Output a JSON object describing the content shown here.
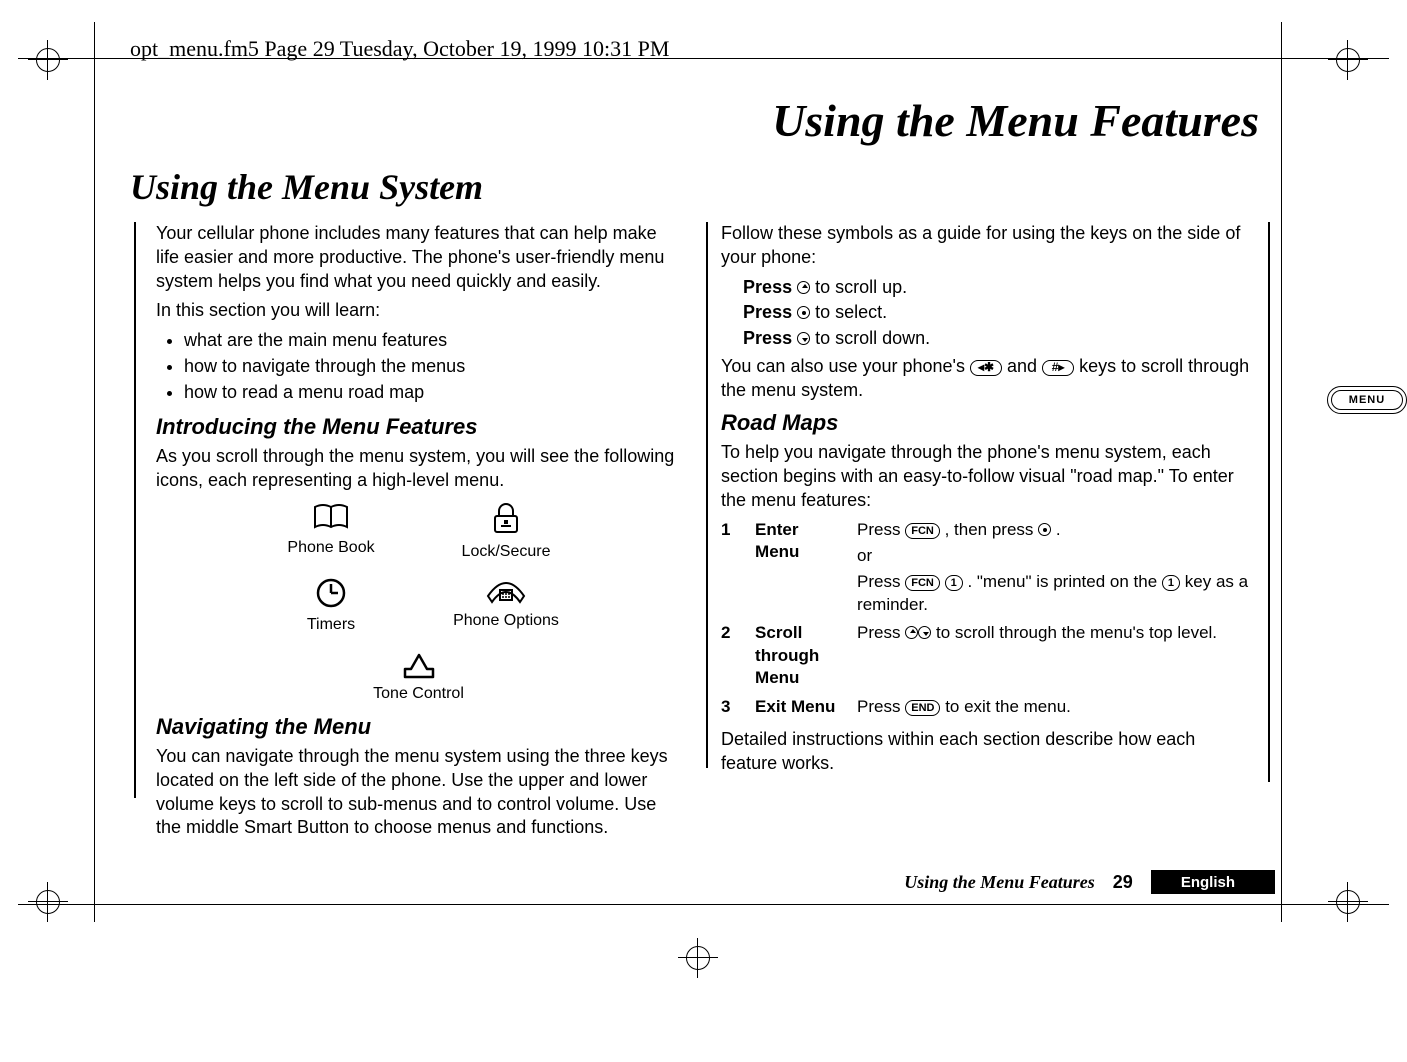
{
  "header": {
    "running_head": "opt_menu.fm5  Page 29  Tuesday, October 19, 1999  10:31 PM"
  },
  "chapter_title": "Using the Menu Features",
  "section_title": "Using the Menu System",
  "left_col": {
    "intro_p1": "Your cellular phone includes many features that can help make life easier and more productive. The phone's user-friendly menu system helps you find what you need quickly and easily.",
    "intro_p2": "In this section you will learn:",
    "bullets": [
      "what are the main menu features",
      "how to navigate through the menus",
      "how to read a menu road map"
    ],
    "h_intro": "Introducing the Menu Features",
    "intro_p3": "As you scroll through the menu system, you will see the following icons, each representing a high-level menu.",
    "icons": {
      "phone_book": "Phone Book",
      "lock_secure": "Lock/Secure",
      "timers": "Timers",
      "phone_options": "Phone Options",
      "tone_control": "Tone Control"
    },
    "h_nav": "Navigating the Menu",
    "nav_p": "You can navigate through the menu system using the three keys located on the left side of the phone. Use the upper and lower volume keys to scroll to sub-menus and to control volume. Use the middle Smart Button to choose menus and functions."
  },
  "right_col": {
    "follow_p": "Follow these symbols as a guide for using the keys on the side of your phone:",
    "press_up_label": "Press",
    "press_up_rest": " to scroll up.",
    "press_sel_label": "Press",
    "press_sel_rest": " to select.",
    "press_down_label": "Press",
    "press_down_rest": " to scroll down.",
    "also_pre": "You can also use your phone's ",
    "also_mid": " and ",
    "also_post": " keys to scroll through the menu system.",
    "arrow_left_label": "◂✱",
    "arrow_right_label": "#▸",
    "h_roadmaps": "Road Maps",
    "road_p": "To help you navigate through the phone's menu system, each section begins with an easy-to-follow visual \"road map.\" To enter the menu features:",
    "fcn_label": "FCN",
    "one_label": "1",
    "end_label": "END",
    "steps": [
      {
        "num": "1",
        "label": "Enter Menu",
        "line1_pre": "Press ",
        "line1_mid": ", then press ",
        "line1_post": ".",
        "or": "or",
        "line2_pre": "Press ",
        "line2_mid1": " ",
        "line2_mid2": ". \"menu\" is printed on the ",
        "line2_post": " key as a reminder."
      },
      {
        "num": "2",
        "label": "Scroll through Menu",
        "line_pre": "Press ",
        "line_post": " to scroll through the menu's top level."
      },
      {
        "num": "3",
        "label": "Exit Menu",
        "line_pre": "Press ",
        "line_post": " to exit the menu."
      }
    ],
    "detail_p": "Detailed instructions within each section describe how each feature works."
  },
  "tab": {
    "label": "MENU"
  },
  "footer": {
    "title": "Using the Menu Features",
    "page_num": "29",
    "language": "English"
  }
}
